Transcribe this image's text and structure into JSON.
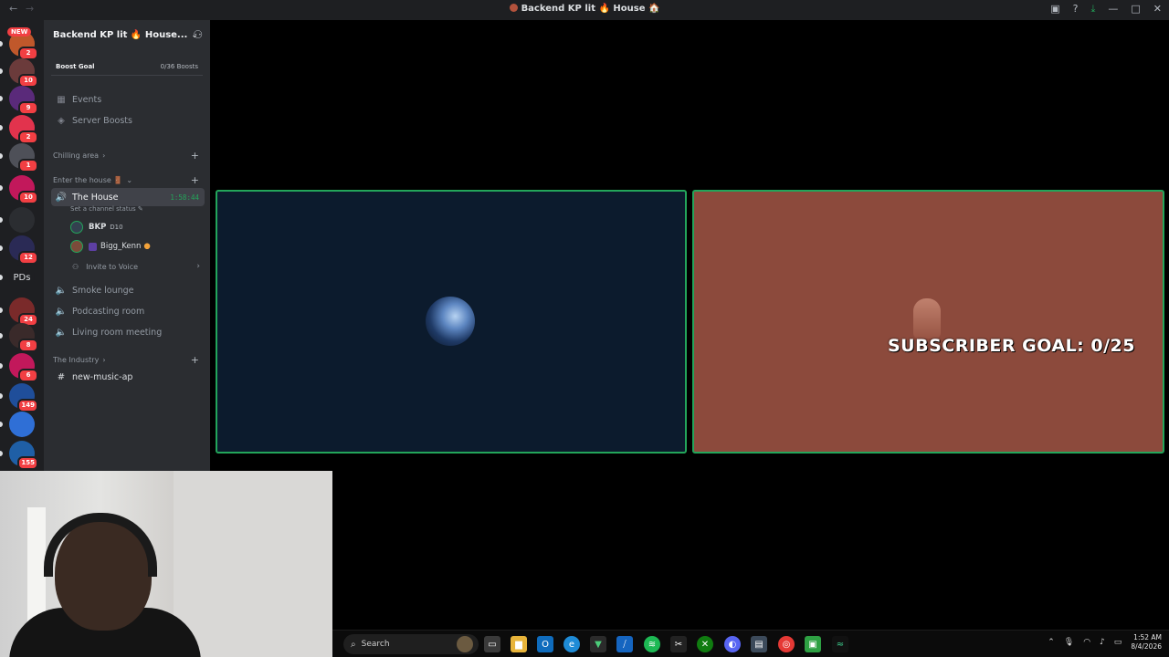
{
  "window": {
    "title": "Backend KP lit 🔥 House 🏠"
  },
  "servers": {
    "new_tag": "NEW",
    "items": [
      {
        "icon": "server-a",
        "badge": "2",
        "color": "#c0582b"
      },
      {
        "icon": "server-b",
        "badge": "10",
        "color": "#6b3b3b"
      },
      {
        "icon": "server-c",
        "badge": "9",
        "color": "#5a2a7a"
      },
      {
        "icon": "discord-red",
        "badge": "2",
        "color": "#e2334d"
      },
      {
        "icon": "discord-gray",
        "badge": "1",
        "color": "#4e5058"
      },
      {
        "icon": "server-d",
        "badge": "10",
        "color": "#c2185b"
      },
      {
        "icon": "server-e",
        "badge": "",
        "color": "#2b2d31"
      },
      {
        "icon": "server-f",
        "badge": "12",
        "color": "#2a2a55"
      },
      {
        "icon": "pds",
        "label": "PDs",
        "badge": "",
        "color": "#1e1f22"
      },
      {
        "icon": "server-g",
        "badge": "24",
        "color": "#7a2a2a"
      },
      {
        "icon": "server-h",
        "badge": "8",
        "color": "#3a2a2a"
      },
      {
        "icon": "server-i",
        "badge": "6",
        "color": "#c2185b"
      },
      {
        "icon": "server-j",
        "badge": "149",
        "color": "#1f4e9a"
      },
      {
        "icon": "server-k",
        "badge": "",
        "color": "#2f6fd6"
      },
      {
        "icon": "server-l",
        "badge": "155",
        "color": "#1f5fa6"
      }
    ]
  },
  "sidebar": {
    "server_name": "Backend KP lit 🔥 House...",
    "boost_goal_label": "Boost Goal",
    "boost_count": "0/36 Boosts",
    "events": "Events",
    "server_boosts": "Server Boosts",
    "cat_chilling": "Chilling area",
    "cat_enter": "Enter the house 🚪",
    "channel_house": "The House",
    "house_timer": "1:58:44",
    "channel_status": "Set a channel status",
    "voice_users": [
      {
        "name": "BKP",
        "tag": "D10"
      },
      {
        "name": "Bigg_Kenn"
      }
    ],
    "invite_voice": "Invite to Voice",
    "channels": [
      "Smoke lounge",
      "Podcasting room",
      "Living room meeting"
    ],
    "cat_industry": "The Industry",
    "text_channel": "new-music-ap"
  },
  "stage": {
    "goal_text": "SUBSCRIBER GOAL: 0/25"
  },
  "taskbar": {
    "search_label": "Search",
    "time": "1:52 AM",
    "date": "8/4/2026"
  }
}
